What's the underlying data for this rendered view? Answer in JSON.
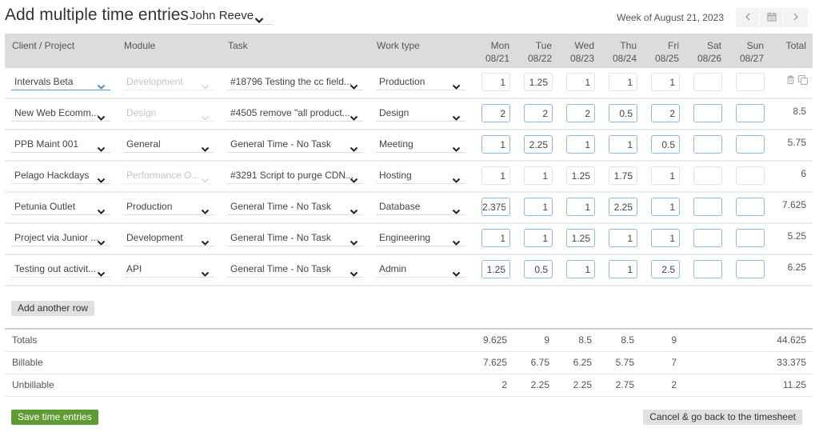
{
  "page": {
    "title": "Add multiple time entries",
    "person_select": {
      "value": "John Reeve",
      "icon": "chevron-down-icon"
    }
  },
  "week": {
    "label": "Week of August 21, 2023",
    "prev_icon": "chevron-left-icon",
    "calendar_icon": "calendar-icon",
    "next_icon": "chevron-right-icon"
  },
  "table": {
    "headers": {
      "client": "Client / Project",
      "module": "Module",
      "task": "Task",
      "worktype": "Work type",
      "total": "Total"
    },
    "days": [
      {
        "name": "Mon",
        "date": "08/21"
      },
      {
        "name": "Tue",
        "date": "08/22"
      },
      {
        "name": "Wed",
        "date": "08/23"
      },
      {
        "name": "Thu",
        "date": "08/24"
      },
      {
        "name": "Fri",
        "date": "08/25"
      },
      {
        "name": "Sat",
        "date": "08/26"
      },
      {
        "name": "Sun",
        "date": "08/27"
      }
    ],
    "rows": [
      {
        "client": "Intervals Beta",
        "client_focused": true,
        "module": "Development",
        "module_disabled": true,
        "task": "#18796 Testing the cc field...",
        "worktype": "Production",
        "hours": [
          "1",
          "1.25",
          "1",
          "1",
          "1",
          "",
          ""
        ],
        "total": "",
        "show_actions": true,
        "active_inputs": false
      },
      {
        "client": "New Web Ecomm...",
        "module": "Design",
        "module_disabled": true,
        "task": "#4505 remove \"all product...",
        "worktype": "Design",
        "hours": [
          "2",
          "2",
          "2",
          "0.5",
          "2",
          "",
          ""
        ],
        "total": "8.5",
        "active_inputs": true
      },
      {
        "client": "PPB Maint 001",
        "module": "General",
        "module_disabled": false,
        "task": "General Time - No Task",
        "worktype": "Meeting",
        "hours": [
          "1",
          "2.25",
          "1",
          "1",
          "0.5",
          "",
          ""
        ],
        "total": "5.75",
        "active_inputs": true
      },
      {
        "client": "Pelago Hackdays",
        "module": "Performance O...",
        "module_disabled": true,
        "task": "#3291 Script to purge CDN...",
        "worktype": "Hosting",
        "hours": [
          "1",
          "1",
          "1.25",
          "1.75",
          "1",
          "",
          ""
        ],
        "total": "6",
        "active_inputs": false
      },
      {
        "client": "Petunia Outlet",
        "module": "Production",
        "module_disabled": false,
        "task": "General Time - No Task",
        "worktype": "Database",
        "hours": [
          "2.375",
          "1",
          "1",
          "2.25",
          "1",
          "",
          ""
        ],
        "total": "7.625",
        "active_inputs": true
      },
      {
        "client": "Project via Junior ...",
        "module": "Development",
        "module_disabled": false,
        "task": "General Time - No Task",
        "worktype": "Engineering",
        "hours": [
          "1",
          "1",
          "1.25",
          "1",
          "1",
          "",
          ""
        ],
        "total": "5.25",
        "active_inputs": true
      },
      {
        "client": "Testing out activit...",
        "module": "API",
        "module_disabled": false,
        "task": "General Time - No Task",
        "worktype": "Admin",
        "hours": [
          "1.25",
          "0.5",
          "1",
          "1",
          "2.5",
          "",
          ""
        ],
        "total": "6.25",
        "active_inputs": true
      }
    ],
    "row_action_icons": [
      "trash-icon",
      "copy-icon"
    ]
  },
  "summary": [
    {
      "label": "Totals",
      "days": [
        "9.625",
        "9",
        "8.5",
        "8.5",
        "9",
        "",
        ""
      ],
      "total": "44.625"
    },
    {
      "label": "Billable",
      "days": [
        "7.625",
        "6.75",
        "6.25",
        "5.75",
        "7",
        "",
        ""
      ],
      "total": "33.375"
    },
    {
      "label": "Unbillable",
      "days": [
        "2",
        "2.25",
        "2.25",
        "2.75",
        "2",
        "",
        ""
      ],
      "total": "11.25"
    }
  ],
  "actions": {
    "add_row": "Add another row",
    "save": "Save time entries",
    "cancel": "Cancel & go back to the timesheet"
  },
  "colors": {
    "header_bg": "#dcdcdc",
    "save_green": "#5e9b32",
    "focus_blue": "#5b9bd5",
    "active_input_border": "#8fb9e8",
    "button_gray": "#e0e0e0"
  }
}
